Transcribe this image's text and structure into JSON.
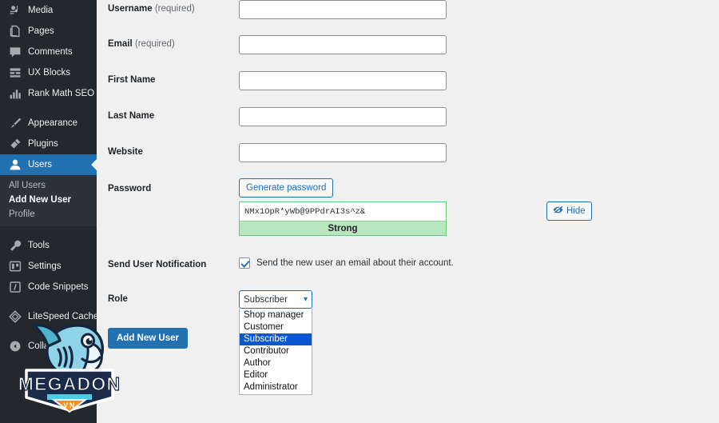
{
  "sidebar": {
    "items": [
      {
        "label": "Media",
        "icon": "media-icon",
        "active": false
      },
      {
        "label": "Pages",
        "icon": "pages-icon",
        "active": false
      },
      {
        "label": "Comments",
        "icon": "comments-icon",
        "active": false
      },
      {
        "label": "UX Blocks",
        "icon": "ux-blocks-icon",
        "active": false
      },
      {
        "label": "Rank Math SEO",
        "icon": "rank-math-icon",
        "active": false
      },
      {
        "label": "Appearance",
        "icon": "appearance-icon",
        "active": false
      },
      {
        "label": "Plugins",
        "icon": "plugins-icon",
        "active": false
      },
      {
        "label": "Users",
        "icon": "users-icon",
        "active": true
      },
      {
        "label": "Tools",
        "icon": "tools-icon",
        "active": false
      },
      {
        "label": "Settings",
        "icon": "settings-icon",
        "active": false
      },
      {
        "label": "Code Snippets",
        "icon": "code-snippets-icon",
        "active": false
      },
      {
        "label": "LiteSpeed Cache",
        "icon": "litespeed-icon",
        "active": false
      },
      {
        "label": "Collapse menu",
        "icon": "collapse-icon",
        "active": false
      }
    ],
    "submenu": [
      {
        "label": "All Users",
        "current": false
      },
      {
        "label": "Add New User",
        "current": true
      },
      {
        "label": "Profile",
        "current": false
      }
    ],
    "colors": {
      "background": "#23282d",
      "submenu_background": "#2c3338",
      "active": "#2271b1",
      "text": "#eeeeee"
    }
  },
  "form": {
    "fields": [
      {
        "label": "Username",
        "required_note": " (required)",
        "value": "",
        "placeholder": ""
      },
      {
        "label": "Email",
        "required_note": " (required)",
        "value": "",
        "placeholder": ""
      },
      {
        "label": "First Name",
        "required_note": "",
        "value": "",
        "placeholder": ""
      },
      {
        "label": "Last Name",
        "required_note": "",
        "value": "",
        "placeholder": ""
      },
      {
        "label": "Website",
        "required_note": "",
        "value": "",
        "placeholder": ""
      }
    ],
    "password": {
      "label": "Password",
      "generate_button": "Generate password",
      "value": "NMx1OpR*yWb@9PPdrAI3s^z&",
      "strength": "Strong",
      "hide_button": "Hide",
      "strength_color": "#b8e6bf"
    },
    "notification": {
      "label": "Send User Notification",
      "checkbox_text": "Send the new user an email about their account.",
      "checked": true
    },
    "role": {
      "label": "Role",
      "selected": "Subscriber",
      "options": [
        "Shop manager",
        "Customer",
        "Subscriber",
        "Contributor",
        "Author",
        "Editor",
        "Administrator"
      ]
    },
    "submit_button": "Add New User"
  },
  "logo": {
    "name": "MEGADON",
    "subtitle": "VN",
    "colors": {
      "shark_light": "#9ad9e8",
      "shark_mid": "#4fb3cc",
      "dark": "#1c2b4a",
      "banner": "#f5901f",
      "stripe": "#4ecde0"
    }
  }
}
